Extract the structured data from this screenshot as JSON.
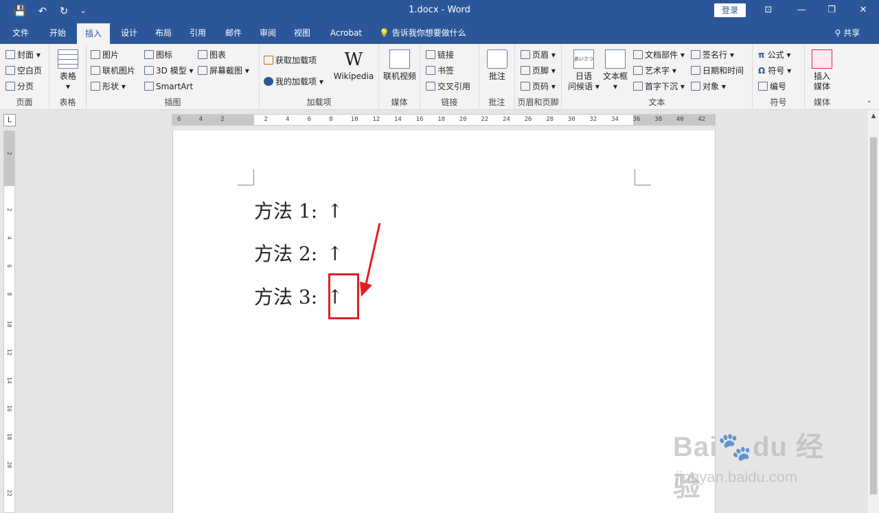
{
  "quick_access": {
    "save": "💾",
    "undo": "↶",
    "redo": "↻",
    "customize": "⌄"
  },
  "title": "1.docx  -  Word",
  "login_label": "登录",
  "window_controls": {
    "restore_ribbon": "⊡",
    "minimize": "—",
    "restore": "❐",
    "close": "✕"
  },
  "tabs": [
    "文件",
    "开始",
    "插入",
    "设计",
    "布局",
    "引用",
    "邮件",
    "审阅",
    "视图",
    "Acrobat"
  ],
  "tell_me": "告诉我你想要做什么",
  "share_label": "共享",
  "ribbon": {
    "pages": {
      "label": "页面",
      "items": [
        "封面",
        "空白页",
        "分页"
      ]
    },
    "table": {
      "label": "表格",
      "button": "表格"
    },
    "illustrations": {
      "label": "插图",
      "items": [
        "图片",
        "联机图片",
        "形状",
        "图标",
        "3D 模型",
        "SmartArt",
        "图表",
        "屏幕截图"
      ]
    },
    "addins": {
      "label": "加载项",
      "items": [
        "获取加载项",
        "我的加载项"
      ],
      "wikipedia": "Wikipedia",
      "wiki_glyph": "W"
    },
    "media": {
      "label": "媒体",
      "button": "联机视频"
    },
    "links": {
      "label": "链接",
      "items": [
        "链接",
        "书签",
        "交叉引用"
      ]
    },
    "comments": {
      "label": "批注",
      "button": "批注"
    },
    "header_footer": {
      "label": "页眉和页脚",
      "items": [
        "页眉",
        "页脚",
        "页码"
      ]
    },
    "text": {
      "label": "文本",
      "greeting": "日语\n问候语",
      "textbox": "文本框",
      "items": [
        "文档部件",
        "艺术字",
        "首字下沉",
        "签名行",
        "日期和时间",
        "对象"
      ],
      "greeting_icon_text": "あいさつ"
    },
    "symbols": {
      "label": "符号",
      "items": [
        "公式",
        "符号",
        "编号"
      ]
    },
    "media2": {
      "label": "媒体",
      "button": "插入\n媒体"
    }
  },
  "tab_selector": "L",
  "hruler_ticks": [
    "6",
    "4",
    "2",
    "",
    "2",
    "4",
    "6",
    "8",
    "10",
    "12",
    "14",
    "16",
    "18",
    "20",
    "22",
    "24",
    "26",
    "28",
    "30",
    "32",
    "34",
    "36",
    "38",
    "40",
    "42"
  ],
  "vruler_ticks": [
    "2",
    "",
    "2",
    "4",
    "6",
    "8",
    "10",
    "12",
    "14",
    "16",
    "18",
    "20",
    "22"
  ],
  "document": {
    "lines": [
      {
        "text": "方法 1:",
        "arrow": "↑"
      },
      {
        "text": "方法 2:",
        "arrow": "↑"
      },
      {
        "text": "方法 3:",
        "arrow": "↑"
      }
    ]
  },
  "watermark": {
    "main": "Bai🐾du 经验",
    "sub": "jingyan.baidu.com"
  },
  "annotation_color": "#e02020",
  "accent": "#2b579a"
}
